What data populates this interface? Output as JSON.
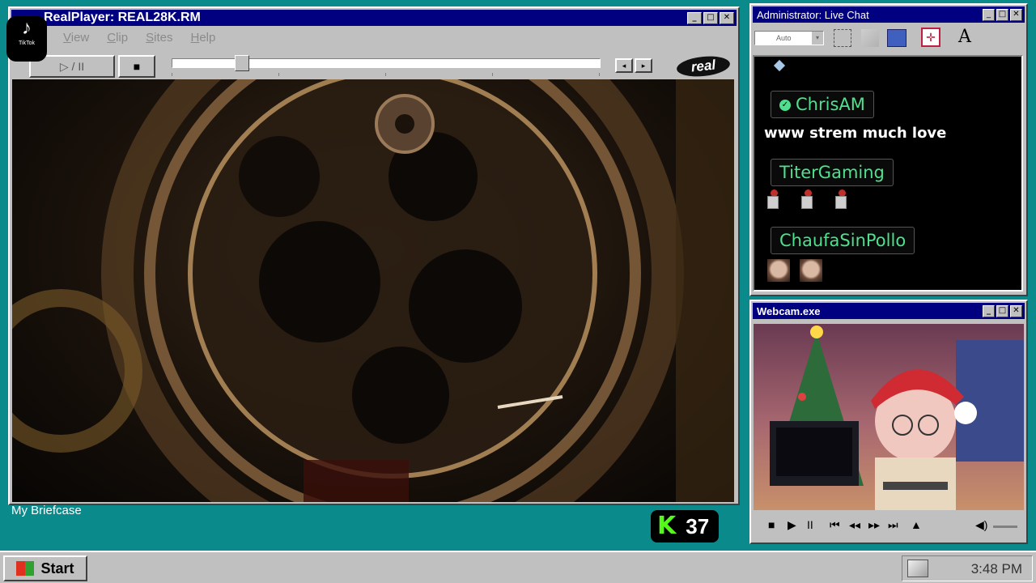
{
  "realplayer": {
    "title": "RealPlayer: REAL28K.RM",
    "menu": [
      "View",
      "Clip",
      "Sites",
      "Help"
    ],
    "play_pause_label": "▷ / II",
    "stop_label": "■",
    "logo_text": "real",
    "seek_position": 0.15
  },
  "desktop": {
    "briefcase_label": "My Briefcase"
  },
  "tiktok": {
    "label": "TikTok"
  },
  "kick": {
    "logo": "K",
    "viewer_count": "37",
    "brand_color": "#53fc18"
  },
  "chat": {
    "title": "Administrator: Live Chat",
    "font_select": "Auto",
    "text_button": "A",
    "messages": [
      {
        "user": "ChrisAM",
        "verified": true,
        "text": "www strem much love"
      },
      {
        "user": "TiterGaming",
        "emotes": [
          "pin-emote",
          "pin-emote",
          "pin-emote"
        ]
      },
      {
        "user": "ChaufaSinPollo",
        "emotes": [
          "face-emote",
          "face-emote"
        ]
      }
    ],
    "name_color": "#4fe08f"
  },
  "webcam": {
    "title": "Webcam.exe"
  },
  "taskbar": {
    "start_label": "Start",
    "clock": "3:48 PM"
  }
}
